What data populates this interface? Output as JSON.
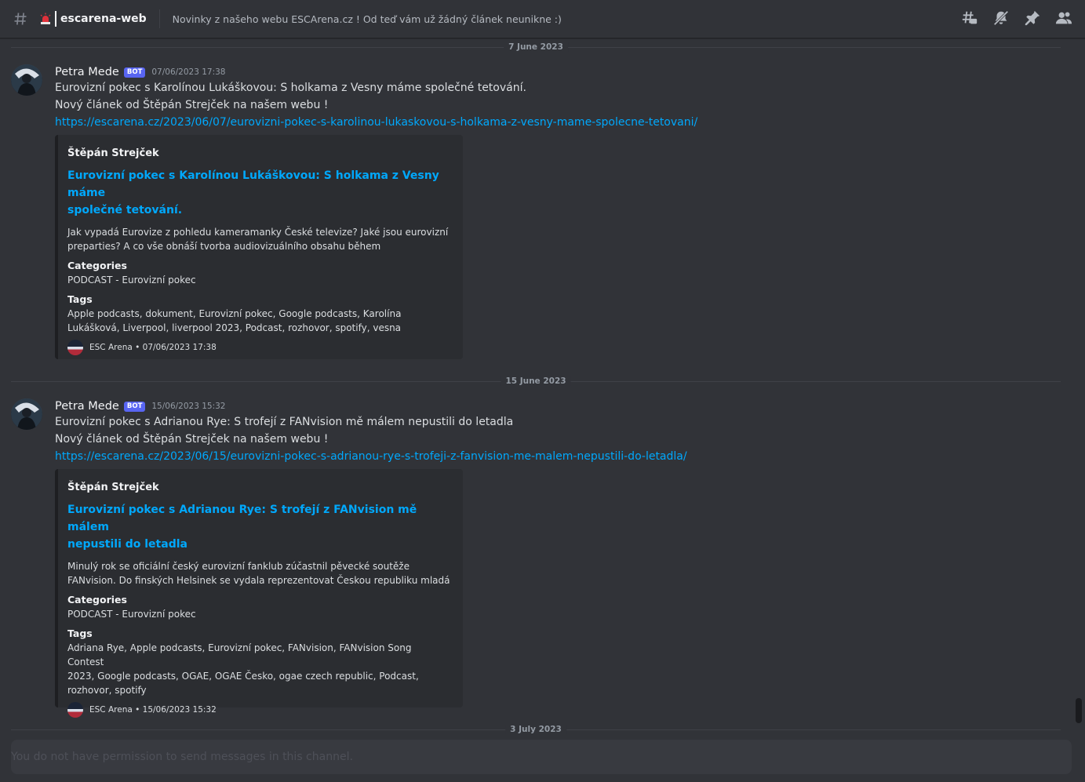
{
  "header": {
    "channel_name": "escarena-web",
    "topic": "Novinky z našeho webu ESCArena.cz ! Od teď vám už žádný článek neunikne :)"
  },
  "date_dividers": [
    "7 June 2023",
    "15 June 2023",
    "3 July 2023"
  ],
  "messages": [
    {
      "author": "Petra Mede",
      "bot_tag": "BOT",
      "timestamp": "07/06/2023 17:38",
      "line1": "Eurovizní pokec s Karolínou Lukáškovou: S holkama z Vesny máme společné tetování.",
      "line2": "Nový článek od Štěpán Strejček na našem webu !",
      "link": "https://escarena.cz/2023/06/07/eurovizni-pokec-s-karolinou-lukaskovou-s-holkama-z-vesny-mame-spolecne-tetovani/",
      "embed": {
        "author": "Štěpán Strejček",
        "title_line1": "Eurovizní pokec s Karolínou Lukáškovou: S holkama z Vesny máme",
        "title_line2": "společné tetování.",
        "desc_line1": "Jak vypadá Eurovize z pohledu kameramanky České televize? Jaké jsou eurovizní",
        "desc_line2": "preparties? A co vše obnáší tvorba audiovizuálního obsahu během",
        "categories_label": "Categories",
        "categories": "PODCAST - Eurovizní pokec",
        "tags_label": "Tags",
        "tags_line1": "Apple podcasts, dokument, Eurovizní pokec, Google podcasts, Karolína",
        "tags_line2": "Lukášková, Liverpool, liverpool 2023, Podcast, rozhovor, spotify, vesna",
        "tags_line3": "",
        "footer": "ESC Arena • 07/06/2023 17:38"
      }
    },
    {
      "author": "Petra Mede",
      "bot_tag": "BOT",
      "timestamp": "15/06/2023 15:32",
      "line1": "Eurovizní pokec s Adrianou Rye: S trofejí z FANvision mě málem nepustili do letadla",
      "line2": "Nový článek od Štěpán Strejček na našem webu !",
      "link": "https://escarena.cz/2023/06/15/eurovizni-pokec-s-adrianou-rye-s-trofeji-z-fanvision-me-malem-nepustili-do-letadla/",
      "embed": {
        "author": "Štěpán Strejček",
        "title_line1": "Eurovizní pokec s Adrianou Rye: S trofejí z FANvision mě málem",
        "title_line2": "nepustili do letadla",
        "desc_line1": "Minulý rok se oficiální český eurovizní fanklub zúčastnil pěvecké soutěže",
        "desc_line2": "FANvision. Do finských Helsinek se vydala reprezentovat Českou republiku mladá",
        "categories_label": "Categories",
        "categories": "PODCAST - Eurovizní pokec",
        "tags_label": "Tags",
        "tags_line1": "Adriana Rye, Apple podcasts, Eurovizní pokec, FANvision, FANvision Song Contest",
        "tags_line2": "2023, Google podcasts, OGAE, OGAE Česko, ogae czech republic, Podcast,",
        "tags_line3": "rozhovor, spotify",
        "footer": "ESC Arena • 15/06/2023 15:32"
      }
    }
  ],
  "input": {
    "placeholder": "You do not have permission to send messages in this channel."
  },
  "icons": {
    "header": [
      "hash-icon",
      "siren-icon"
    ],
    "toolbar": [
      "threads-icon",
      "mute-icon",
      "pin-icon",
      "members-icon"
    ]
  },
  "colors": {
    "background": "#313338",
    "link": "#00a8fc",
    "bot_tag": "#5865f2",
    "embed_bg": "#2b2d31"
  }
}
